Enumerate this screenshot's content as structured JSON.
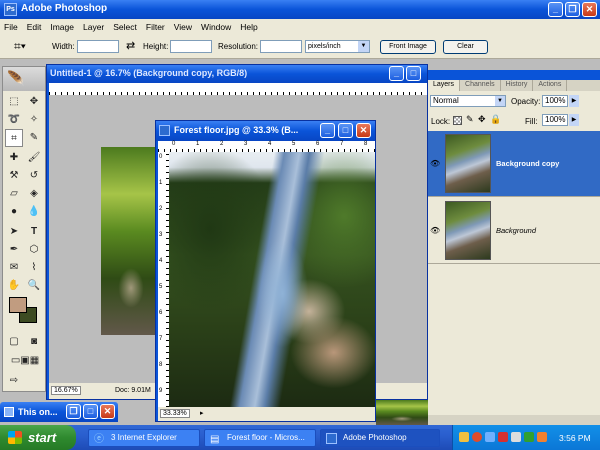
{
  "app": {
    "title": "Adobe Photoshop"
  },
  "menu": [
    "File",
    "Edit",
    "Image",
    "Layer",
    "Select",
    "Filter",
    "View",
    "Window",
    "Help"
  ],
  "options": {
    "width_label": "Width:",
    "height_label": "Height:",
    "resolution_label": "Resolution:",
    "units": "pixels/inch",
    "front_image": "Front Image",
    "clear": "Clear"
  },
  "doc1": {
    "title": "Untitled-1 @ 16.7% (Background copy, RGB/8)",
    "zoom": "16.67%",
    "doc_size": "Doc: 9.01M"
  },
  "doc2": {
    "title": "Forest floor.jpg @ 33.3% (B...",
    "zoom": "33.33%",
    "ruler_labels": [
      "0",
      "1",
      "2",
      "3",
      "4",
      "5",
      "6",
      "7",
      "8"
    ],
    "vruler_labels": [
      "0",
      "1",
      "2",
      "3",
      "4",
      "5",
      "6",
      "7",
      "8",
      "9"
    ]
  },
  "layers_panel": {
    "tabs": [
      "Layers",
      "Channels",
      "History",
      "Actions"
    ],
    "blend_mode": "Normal",
    "opacity_label": "Opacity:",
    "opacity": "100%",
    "lock_label": "Lock:",
    "fill_label": "Fill:",
    "fill": "100%",
    "layers": [
      {
        "name": "Background copy",
        "selected": true
      },
      {
        "name": "Background",
        "selected": false
      }
    ]
  },
  "mini_window": {
    "title": "This on..."
  },
  "taskbar": {
    "start": "start",
    "tasks": [
      "3 Internet Explorer",
      "Forest floor - Micros...",
      "Adobe Photoshop"
    ],
    "clock": "3:56 PM"
  },
  "colors": {
    "foreground": "#c19c80",
    "background": "#3d4b22",
    "selection": "#316ac5"
  }
}
